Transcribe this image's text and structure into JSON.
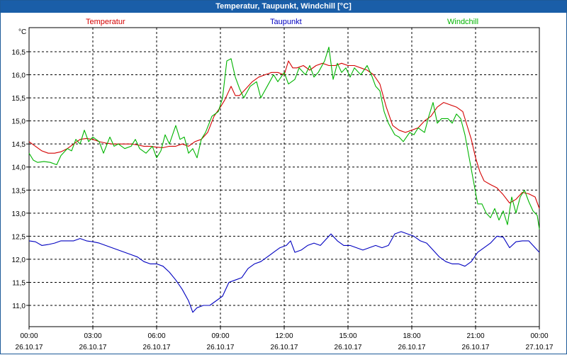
{
  "window": {
    "title": "Temperatur, Taupunkt, Windchill [°C]"
  },
  "colors": {
    "titlebar": "#1a5ea8",
    "temperature": "#d40000",
    "dewpoint": "#0000c0",
    "windchill": "#00b400"
  },
  "chart_data": {
    "type": "line",
    "title": "Temperatur, Taupunkt, Windchill [°C]",
    "ylabel": "°C",
    "ylim": [
      10.5,
      17.1
    ],
    "xlim": [
      0,
      24
    ],
    "grid": true,
    "legend_placement": "top",
    "yticks": [
      "16,5",
      "16,0",
      "15,5",
      "15,0",
      "14,5",
      "14,0",
      "13,5",
      "13,0",
      "12,5",
      "12,0",
      "11,5",
      "11,0"
    ],
    "ytick_values": [
      16.5,
      16.0,
      15.5,
      15.0,
      14.5,
      14.0,
      13.5,
      13.0,
      12.5,
      12.0,
      11.5,
      11.0
    ],
    "xticks": [
      {
        "time": "00:00",
        "date": "26.10.17"
      },
      {
        "time": "03:00",
        "date": "26.10.17"
      },
      {
        "time": "06:00",
        "date": "26.10.17"
      },
      {
        "time": "09:00",
        "date": "26.10.17"
      },
      {
        "time": "12:00",
        "date": "26.10.17"
      },
      {
        "time": "15:00",
        "date": "26.10.17"
      },
      {
        "time": "18:00",
        "date": "26.10.17"
      },
      {
        "time": "21:00",
        "date": "26.10.17"
      },
      {
        "time": "00:00",
        "date": "27.10.17"
      }
    ],
    "series": [
      {
        "name": "Temperatur",
        "color": "#d40000",
        "points": [
          [
            0.0,
            14.55
          ],
          [
            0.3,
            14.45
          ],
          [
            0.6,
            14.35
          ],
          [
            0.9,
            14.3
          ],
          [
            1.2,
            14.3
          ],
          [
            1.5,
            14.33
          ],
          [
            1.8,
            14.4
          ],
          [
            2.1,
            14.5
          ],
          [
            2.4,
            14.6
          ],
          [
            2.7,
            14.62
          ],
          [
            3.0,
            14.6
          ],
          [
            3.3,
            14.55
          ],
          [
            3.6,
            14.52
          ],
          [
            3.9,
            14.5
          ],
          [
            4.2,
            14.5
          ],
          [
            4.5,
            14.5
          ],
          [
            4.8,
            14.5
          ],
          [
            5.1,
            14.48
          ],
          [
            5.4,
            14.45
          ],
          [
            5.7,
            14.45
          ],
          [
            6.0,
            14.43
          ],
          [
            6.3,
            14.42
          ],
          [
            6.6,
            14.45
          ],
          [
            6.9,
            14.45
          ],
          [
            7.2,
            14.5
          ],
          [
            7.5,
            14.45
          ],
          [
            7.8,
            14.55
          ],
          [
            8.1,
            14.6
          ],
          [
            8.4,
            14.75
          ],
          [
            8.7,
            15.1
          ],
          [
            9.0,
            15.3
          ],
          [
            9.2,
            15.45
          ],
          [
            9.4,
            15.65
          ],
          [
            9.5,
            15.75
          ],
          [
            9.7,
            15.55
          ],
          [
            9.9,
            15.55
          ],
          [
            10.2,
            15.7
          ],
          [
            10.5,
            15.85
          ],
          [
            10.8,
            15.95
          ],
          [
            11.1,
            16.0
          ],
          [
            11.4,
            16.05
          ],
          [
            11.7,
            16.05
          ],
          [
            12.0,
            16.0
          ],
          [
            12.2,
            16.3
          ],
          [
            12.4,
            16.15
          ],
          [
            12.6,
            16.15
          ],
          [
            12.9,
            16.2
          ],
          [
            13.2,
            16.1
          ],
          [
            13.5,
            16.2
          ],
          [
            13.8,
            16.25
          ],
          [
            14.1,
            16.2
          ],
          [
            14.4,
            16.2
          ],
          [
            14.7,
            16.25
          ],
          [
            15.0,
            16.2
          ],
          [
            15.3,
            16.2
          ],
          [
            15.6,
            16.15
          ],
          [
            15.9,
            16.1
          ],
          [
            16.2,
            16.0
          ],
          [
            16.5,
            15.8
          ],
          [
            16.8,
            15.3
          ],
          [
            17.1,
            14.9
          ],
          [
            17.4,
            14.8
          ],
          [
            17.7,
            14.75
          ],
          [
            18.0,
            14.8
          ],
          [
            18.3,
            14.85
          ],
          [
            18.6,
            15.0
          ],
          [
            18.9,
            15.1
          ],
          [
            19.2,
            15.3
          ],
          [
            19.5,
            15.4
          ],
          [
            19.8,
            15.35
          ],
          [
            20.1,
            15.3
          ],
          [
            20.4,
            15.2
          ],
          [
            20.6,
            14.9
          ],
          [
            20.8,
            14.6
          ],
          [
            21.0,
            14.2
          ],
          [
            21.2,
            13.9
          ],
          [
            21.4,
            13.7
          ],
          [
            21.7,
            13.62
          ],
          [
            22.0,
            13.55
          ],
          [
            22.3,
            13.4
          ],
          [
            22.6,
            13.22
          ],
          [
            22.9,
            13.3
          ],
          [
            23.2,
            13.45
          ],
          [
            23.5,
            13.42
          ],
          [
            23.8,
            13.35
          ],
          [
            24.0,
            13.1
          ]
        ]
      },
      {
        "name": "Taupunkt",
        "color": "#0000c0",
        "points": [
          [
            0.0,
            12.4
          ],
          [
            0.3,
            12.38
          ],
          [
            0.6,
            12.3
          ],
          [
            0.9,
            12.32
          ],
          [
            1.2,
            12.35
          ],
          [
            1.5,
            12.4
          ],
          [
            1.8,
            12.4
          ],
          [
            2.1,
            12.4
          ],
          [
            2.4,
            12.45
          ],
          [
            2.7,
            12.4
          ],
          [
            3.0,
            12.38
          ],
          [
            3.3,
            12.35
          ],
          [
            3.6,
            12.3
          ],
          [
            3.9,
            12.25
          ],
          [
            4.2,
            12.2
          ],
          [
            4.5,
            12.15
          ],
          [
            4.8,
            12.1
          ],
          [
            5.1,
            12.05
          ],
          [
            5.4,
            11.95
          ],
          [
            5.7,
            11.9
          ],
          [
            6.0,
            11.9
          ],
          [
            6.3,
            11.85
          ],
          [
            6.6,
            11.72
          ],
          [
            6.9,
            11.55
          ],
          [
            7.2,
            11.35
          ],
          [
            7.5,
            11.1
          ],
          [
            7.7,
            10.85
          ],
          [
            7.9,
            10.95
          ],
          [
            8.2,
            11.0
          ],
          [
            8.5,
            11.0
          ],
          [
            8.8,
            11.1
          ],
          [
            9.1,
            11.2
          ],
          [
            9.4,
            11.5
          ],
          [
            9.7,
            11.55
          ],
          [
            10.0,
            11.6
          ],
          [
            10.3,
            11.8
          ],
          [
            10.6,
            11.9
          ],
          [
            10.9,
            11.95
          ],
          [
            11.2,
            12.05
          ],
          [
            11.5,
            12.15
          ],
          [
            11.8,
            12.25
          ],
          [
            12.1,
            12.3
          ],
          [
            12.3,
            12.4
          ],
          [
            12.5,
            12.15
          ],
          [
            12.8,
            12.2
          ],
          [
            13.1,
            12.3
          ],
          [
            13.4,
            12.35
          ],
          [
            13.7,
            12.3
          ],
          [
            14.0,
            12.45
          ],
          [
            14.2,
            12.55
          ],
          [
            14.5,
            12.4
          ],
          [
            14.8,
            12.3
          ],
          [
            15.1,
            12.3
          ],
          [
            15.4,
            12.25
          ],
          [
            15.7,
            12.2
          ],
          [
            16.0,
            12.25
          ],
          [
            16.3,
            12.3
          ],
          [
            16.6,
            12.25
          ],
          [
            16.9,
            12.3
          ],
          [
            17.2,
            12.55
          ],
          [
            17.5,
            12.6
          ],
          [
            17.8,
            12.55
          ],
          [
            18.1,
            12.5
          ],
          [
            18.4,
            12.4
          ],
          [
            18.7,
            12.35
          ],
          [
            19.0,
            12.2
          ],
          [
            19.3,
            12.05
          ],
          [
            19.6,
            11.95
          ],
          [
            19.9,
            11.9
          ],
          [
            20.2,
            11.9
          ],
          [
            20.5,
            11.85
          ],
          [
            20.8,
            11.95
          ],
          [
            21.1,
            12.15
          ],
          [
            21.4,
            12.25
          ],
          [
            21.7,
            12.35
          ],
          [
            22.0,
            12.5
          ],
          [
            22.3,
            12.48
          ],
          [
            22.6,
            12.25
          ],
          [
            22.9,
            12.38
          ],
          [
            23.2,
            12.4
          ],
          [
            23.5,
            12.4
          ],
          [
            23.8,
            12.25
          ],
          [
            24.0,
            12.15
          ]
        ]
      },
      {
        "name": "Windchill",
        "color": "#00b400",
        "points": [
          [
            0.0,
            14.3
          ],
          [
            0.2,
            14.15
          ],
          [
            0.4,
            14.1
          ],
          [
            0.7,
            14.12
          ],
          [
            1.0,
            14.1
          ],
          [
            1.3,
            14.05
          ],
          [
            1.5,
            14.25
          ],
          [
            1.8,
            14.4
          ],
          [
            2.0,
            14.35
          ],
          [
            2.2,
            14.6
          ],
          [
            2.4,
            14.5
          ],
          [
            2.6,
            14.8
          ],
          [
            2.8,
            14.55
          ],
          [
            3.0,
            14.65
          ],
          [
            3.3,
            14.55
          ],
          [
            3.5,
            14.3
          ],
          [
            3.8,
            14.65
          ],
          [
            4.0,
            14.45
          ],
          [
            4.2,
            14.5
          ],
          [
            4.5,
            14.4
          ],
          [
            4.8,
            14.45
          ],
          [
            5.0,
            14.6
          ],
          [
            5.2,
            14.4
          ],
          [
            5.5,
            14.3
          ],
          [
            5.8,
            14.45
          ],
          [
            6.0,
            14.2
          ],
          [
            6.2,
            14.35
          ],
          [
            6.4,
            14.7
          ],
          [
            6.6,
            14.5
          ],
          [
            6.9,
            14.9
          ],
          [
            7.1,
            14.6
          ],
          [
            7.3,
            14.65
          ],
          [
            7.5,
            14.3
          ],
          [
            7.7,
            14.4
          ],
          [
            7.9,
            14.2
          ],
          [
            8.1,
            14.6
          ],
          [
            8.3,
            14.75
          ],
          [
            8.6,
            15.1
          ],
          [
            8.9,
            15.2
          ],
          [
            9.1,
            15.5
          ],
          [
            9.3,
            16.3
          ],
          [
            9.5,
            16.35
          ],
          [
            9.7,
            15.95
          ],
          [
            9.9,
            15.7
          ],
          [
            10.1,
            15.5
          ],
          [
            10.4,
            15.75
          ],
          [
            10.7,
            15.85
          ],
          [
            10.9,
            15.5
          ],
          [
            11.2,
            15.75
          ],
          [
            11.5,
            16.0
          ],
          [
            11.7,
            15.85
          ],
          [
            12.0,
            16.05
          ],
          [
            12.2,
            15.8
          ],
          [
            12.5,
            15.9
          ],
          [
            12.7,
            16.15
          ],
          [
            13.0,
            16.0
          ],
          [
            13.2,
            16.2
          ],
          [
            13.4,
            15.95
          ],
          [
            13.6,
            16.05
          ],
          [
            13.9,
            16.3
          ],
          [
            14.1,
            16.6
          ],
          [
            14.3,
            15.9
          ],
          [
            14.5,
            16.25
          ],
          [
            14.7,
            16.05
          ],
          [
            14.9,
            16.15
          ],
          [
            15.1,
            15.95
          ],
          [
            15.3,
            16.15
          ],
          [
            15.6,
            16.0
          ],
          [
            15.9,
            16.2
          ],
          [
            16.1,
            16.0
          ],
          [
            16.3,
            15.75
          ],
          [
            16.5,
            15.65
          ],
          [
            16.7,
            15.2
          ],
          [
            16.9,
            14.95
          ],
          [
            17.2,
            14.7
          ],
          [
            17.4,
            14.65
          ],
          [
            17.6,
            14.55
          ],
          [
            17.9,
            14.75
          ],
          [
            18.1,
            14.7
          ],
          [
            18.3,
            14.85
          ],
          [
            18.6,
            14.75
          ],
          [
            18.8,
            15.1
          ],
          [
            19.0,
            15.4
          ],
          [
            19.2,
            14.95
          ],
          [
            19.4,
            15.05
          ],
          [
            19.7,
            15.05
          ],
          [
            19.9,
            14.95
          ],
          [
            20.1,
            15.15
          ],
          [
            20.3,
            15.05
          ],
          [
            20.5,
            14.7
          ],
          [
            20.7,
            14.2
          ],
          [
            20.9,
            13.7
          ],
          [
            21.1,
            13.2
          ],
          [
            21.3,
            13.2
          ],
          [
            21.5,
            13.0
          ],
          [
            21.7,
            12.9
          ],
          [
            21.9,
            13.1
          ],
          [
            22.1,
            12.85
          ],
          [
            22.3,
            13.05
          ],
          [
            22.5,
            12.75
          ],
          [
            22.7,
            13.35
          ],
          [
            22.9,
            13.0
          ],
          [
            23.1,
            13.35
          ],
          [
            23.3,
            13.5
          ],
          [
            23.5,
            13.25
          ],
          [
            23.7,
            13.05
          ],
          [
            23.9,
            12.95
          ],
          [
            24.0,
            12.65
          ]
        ]
      }
    ]
  }
}
